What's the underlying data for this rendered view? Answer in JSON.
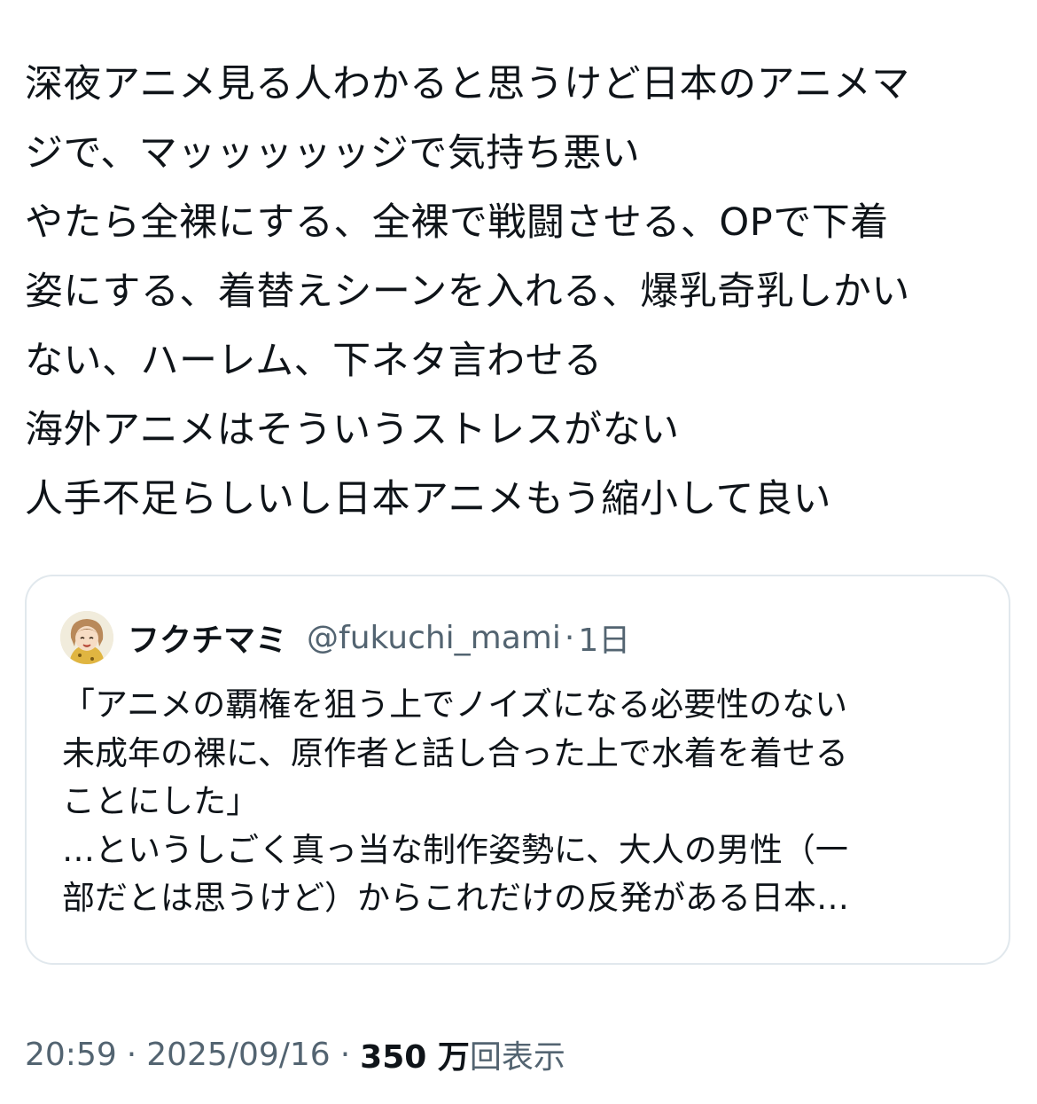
{
  "tweet": {
    "lines": [
      "深夜アニメ見る人わかると思うけど日本のアニメマ",
      "ジで、マッッッッッジで気持ち悪い",
      "やたら全裸にする、全裸で戦闘させる、OPで下着",
      "姿にする、着替えシーンを入れる、爆乳奇乳しかい",
      "ない、ハーレム、下ネタ言わせる",
      "海外アニメはそういうストレスがない",
      "人手不足らしいし日本アニメもう縮小して良い"
    ]
  },
  "quote": {
    "avatar_icon": "illustrated-avatar-icon",
    "author_name": "フクチマミ",
    "handle": "@fukuchi_mami",
    "separator": "·",
    "age": "1日",
    "lines": [
      "「アニメの覇権を狙う上でノイズになる必要性のない",
      "未成年の裸に、原作者と話し合った上で水着を着せる",
      "ことにした」",
      "…というしごく真っ当な制作姿勢に、大人の男性（一",
      "部だとは思うけど）からこれだけの反発がある日本…"
    ]
  },
  "meta": {
    "time": "20:59",
    "separator": "·",
    "date": "2025/09/16",
    "views_count": "350 万",
    "views_label": "回表示"
  },
  "colors": {
    "text_primary": "#0f1419",
    "text_secondary": "#536471",
    "card_border": "#e1e8ed",
    "background": "#ffffff"
  }
}
